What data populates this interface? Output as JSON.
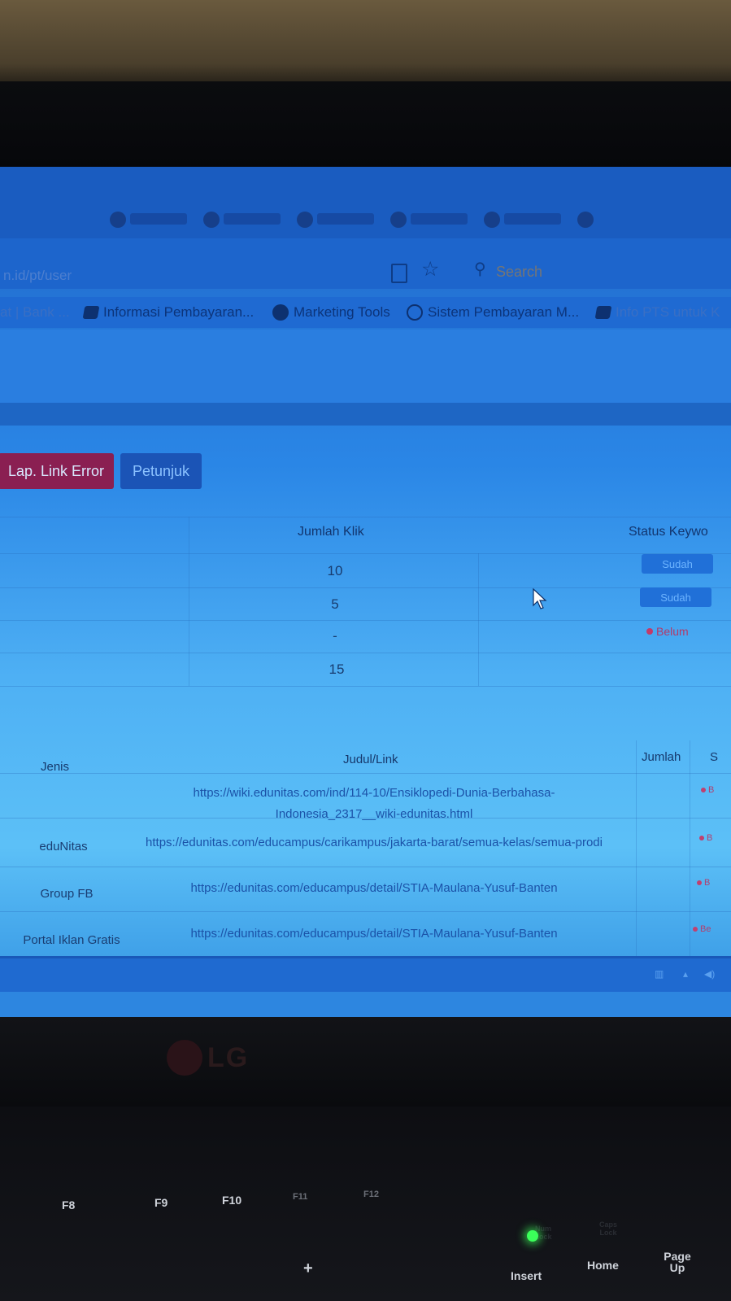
{
  "browser": {
    "url_text": "n.id/pt/user",
    "search_placeholder": "Search",
    "bookmarks": [
      "at | Bank ...",
      "Informasi Pembayaran...",
      "Marketing Tools",
      "Sistem Pembayaran M...",
      "Info PTS untuk K"
    ]
  },
  "actions": {
    "link_error_label": "Lap. Link Error",
    "help_label": "Petunjuk"
  },
  "summary_table": {
    "headers": {
      "clicks": "Jumlah Klik",
      "status": "Status Keywo"
    },
    "rows": [
      {
        "clicks": "10",
        "status": "Sudah"
      },
      {
        "clicks": "5",
        "status": "Sudah"
      },
      {
        "clicks": "-",
        "status": "Belum"
      },
      {
        "clicks": "15",
        "status": ""
      }
    ]
  },
  "links_table": {
    "headers": {
      "type": "Jenis",
      "link": "Judul/Link",
      "count": "Jumlah",
      "status": "S"
    },
    "rows": [
      {
        "type": "",
        "link": "https://wiki.edunitas.com/ind/114-10/Ensiklopedi-Dunia-Berbahasa-Indonesia_2317__wiki-edunitas.html",
        "status": "B"
      },
      {
        "type": "eduNitas",
        "link": "https://edunitas.com/educampus/carikampus/jakarta-barat/semua-kelas/semua-prodi",
        "status": "B"
      },
      {
        "type": "Group FB",
        "link": "https://edunitas.com/educampus/detail/STIA-Maulana-Yusuf-Banten",
        "status": "B"
      },
      {
        "type": "Portal Iklan Gratis",
        "link": "https://edunitas.com/educampus/detail/STIA-Maulana-Yusuf-Banten",
        "status": "Be"
      }
    ]
  },
  "laptop": {
    "brand": "LG",
    "keys": [
      "F8",
      "F9",
      "F10",
      "F11",
      "F12",
      "Home",
      "Page Up",
      "Insert",
      "Num Lock",
      "Caps Lock",
      "+"
    ]
  }
}
